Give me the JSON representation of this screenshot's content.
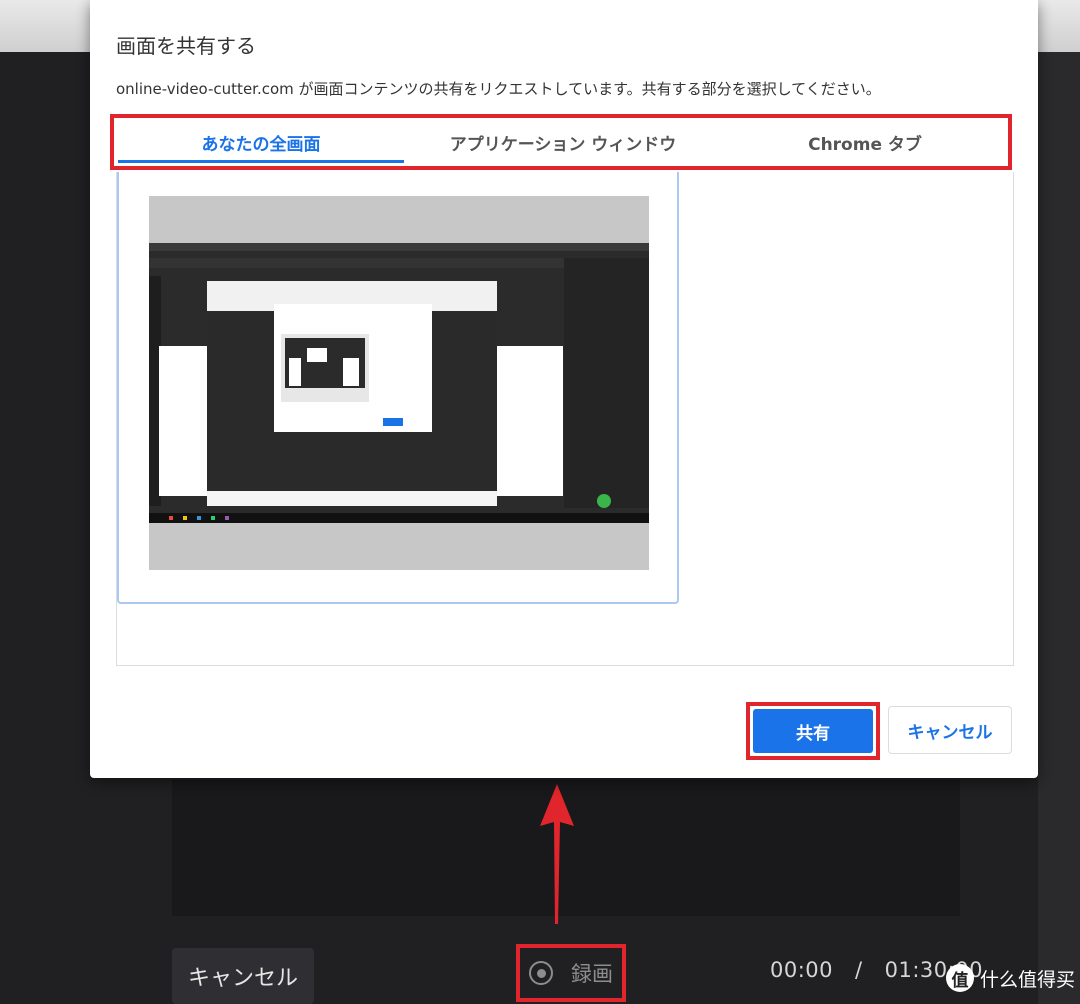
{
  "dialog": {
    "title": "画面を共有する",
    "description": "online-video-cutter.com が画面コンテンツの共有をリクエストしています。共有する部分を選択してください。",
    "tabs": [
      {
        "label": "あなたの全画面",
        "active": true
      },
      {
        "label": "アプリケーション ウィンドウ",
        "active": false
      },
      {
        "label": "Chrome タブ",
        "active": false
      }
    ],
    "share_label": "共有",
    "cancel_label": "キャンセル"
  },
  "background": {
    "cancel_label": "キャンセル",
    "record_label": "録画",
    "time_current": "00:00",
    "time_separator": "/",
    "time_total": "01:30:00"
  },
  "watermark": {
    "logo_char": "值",
    "text": "什么值得买"
  },
  "colors": {
    "accent": "#1a73e8",
    "highlight_red": "#e0262c",
    "dark_bg": "#202022"
  },
  "icons": {
    "record": "record-icon",
    "arrow": "red-up-arrow-icon"
  }
}
